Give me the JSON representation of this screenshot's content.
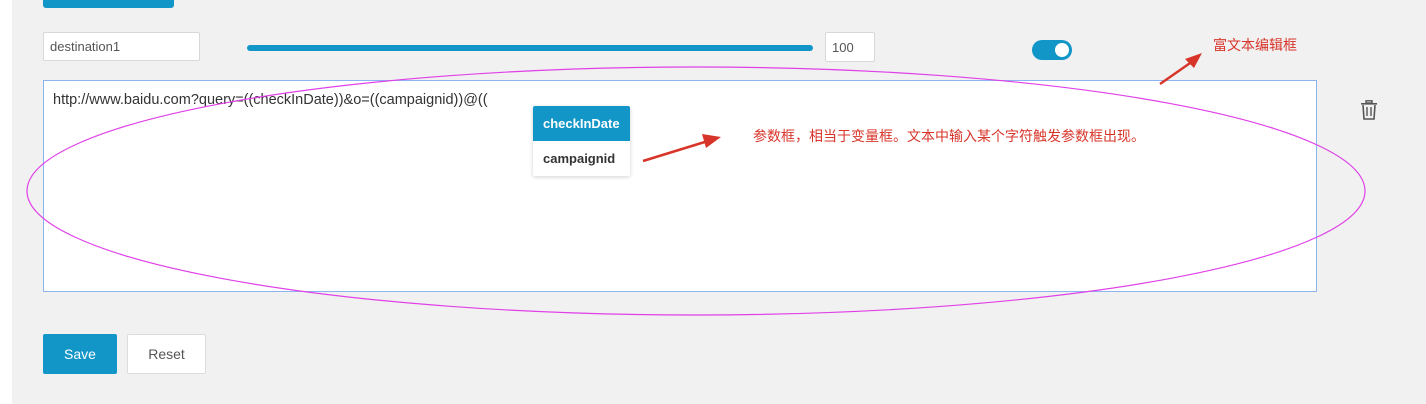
{
  "form": {
    "name_value": "destination1",
    "slider_value_percent": 100,
    "number_value": "100",
    "toggle_on": true
  },
  "editor": {
    "content": "http://www.baidu.com?query=((checkInDate))&o=((campaignid))@(("
  },
  "dropdown": {
    "items": [
      {
        "label": "checkInDate",
        "active": true
      },
      {
        "label": "campaignid",
        "active": false
      }
    ]
  },
  "actions": {
    "save_label": "Save",
    "reset_label": "Reset"
  },
  "annotations": {
    "rich_text_editor": "富文本编辑框",
    "param_box": "参数框，相当于变量框。文本中输入某个字符触发参数框出现。",
    "color": "#d8352a",
    "ellipse_color": "#e040e8"
  },
  "icons": {
    "trash": "trash-icon"
  },
  "colors": {
    "accent": "#1296c8",
    "editor_border": "#8cb4f0"
  }
}
